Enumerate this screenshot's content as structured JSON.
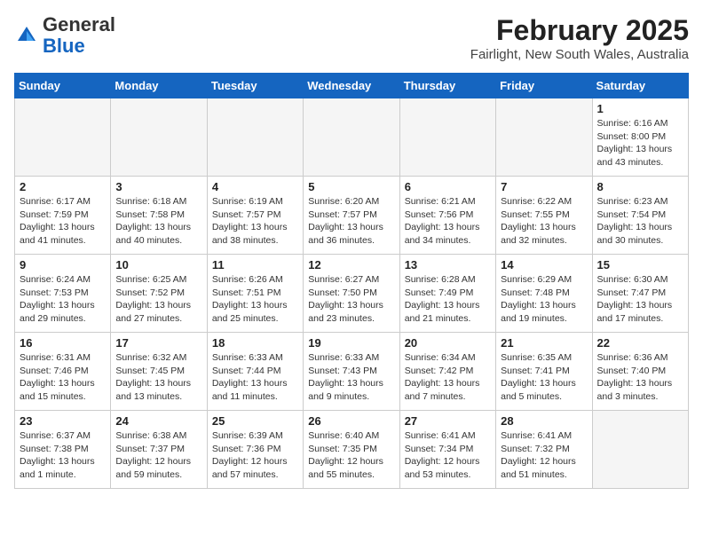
{
  "logo": {
    "general": "General",
    "blue": "Blue"
  },
  "title": "February 2025",
  "location": "Fairlight, New South Wales, Australia",
  "days_of_week": [
    "Sunday",
    "Monday",
    "Tuesday",
    "Wednesday",
    "Thursday",
    "Friday",
    "Saturday"
  ],
  "weeks": [
    [
      {
        "day": "",
        "detail": ""
      },
      {
        "day": "",
        "detail": ""
      },
      {
        "day": "",
        "detail": ""
      },
      {
        "day": "",
        "detail": ""
      },
      {
        "day": "",
        "detail": ""
      },
      {
        "day": "",
        "detail": ""
      },
      {
        "day": "1",
        "detail": "Sunrise: 6:16 AM\nSunset: 8:00 PM\nDaylight: 13 hours\nand 43 minutes."
      }
    ],
    [
      {
        "day": "2",
        "detail": "Sunrise: 6:17 AM\nSunset: 7:59 PM\nDaylight: 13 hours\nand 41 minutes."
      },
      {
        "day": "3",
        "detail": "Sunrise: 6:18 AM\nSunset: 7:58 PM\nDaylight: 13 hours\nand 40 minutes."
      },
      {
        "day": "4",
        "detail": "Sunrise: 6:19 AM\nSunset: 7:57 PM\nDaylight: 13 hours\nand 38 minutes."
      },
      {
        "day": "5",
        "detail": "Sunrise: 6:20 AM\nSunset: 7:57 PM\nDaylight: 13 hours\nand 36 minutes."
      },
      {
        "day": "6",
        "detail": "Sunrise: 6:21 AM\nSunset: 7:56 PM\nDaylight: 13 hours\nand 34 minutes."
      },
      {
        "day": "7",
        "detail": "Sunrise: 6:22 AM\nSunset: 7:55 PM\nDaylight: 13 hours\nand 32 minutes."
      },
      {
        "day": "8",
        "detail": "Sunrise: 6:23 AM\nSunset: 7:54 PM\nDaylight: 13 hours\nand 30 minutes."
      }
    ],
    [
      {
        "day": "9",
        "detail": "Sunrise: 6:24 AM\nSunset: 7:53 PM\nDaylight: 13 hours\nand 29 minutes."
      },
      {
        "day": "10",
        "detail": "Sunrise: 6:25 AM\nSunset: 7:52 PM\nDaylight: 13 hours\nand 27 minutes."
      },
      {
        "day": "11",
        "detail": "Sunrise: 6:26 AM\nSunset: 7:51 PM\nDaylight: 13 hours\nand 25 minutes."
      },
      {
        "day": "12",
        "detail": "Sunrise: 6:27 AM\nSunset: 7:50 PM\nDaylight: 13 hours\nand 23 minutes."
      },
      {
        "day": "13",
        "detail": "Sunrise: 6:28 AM\nSunset: 7:49 PM\nDaylight: 13 hours\nand 21 minutes."
      },
      {
        "day": "14",
        "detail": "Sunrise: 6:29 AM\nSunset: 7:48 PM\nDaylight: 13 hours\nand 19 minutes."
      },
      {
        "day": "15",
        "detail": "Sunrise: 6:30 AM\nSunset: 7:47 PM\nDaylight: 13 hours\nand 17 minutes."
      }
    ],
    [
      {
        "day": "16",
        "detail": "Sunrise: 6:31 AM\nSunset: 7:46 PM\nDaylight: 13 hours\nand 15 minutes."
      },
      {
        "day": "17",
        "detail": "Sunrise: 6:32 AM\nSunset: 7:45 PM\nDaylight: 13 hours\nand 13 minutes."
      },
      {
        "day": "18",
        "detail": "Sunrise: 6:33 AM\nSunset: 7:44 PM\nDaylight: 13 hours\nand 11 minutes."
      },
      {
        "day": "19",
        "detail": "Sunrise: 6:33 AM\nSunset: 7:43 PM\nDaylight: 13 hours\nand 9 minutes."
      },
      {
        "day": "20",
        "detail": "Sunrise: 6:34 AM\nSunset: 7:42 PM\nDaylight: 13 hours\nand 7 minutes."
      },
      {
        "day": "21",
        "detail": "Sunrise: 6:35 AM\nSunset: 7:41 PM\nDaylight: 13 hours\nand 5 minutes."
      },
      {
        "day": "22",
        "detail": "Sunrise: 6:36 AM\nSunset: 7:40 PM\nDaylight: 13 hours\nand 3 minutes."
      }
    ],
    [
      {
        "day": "23",
        "detail": "Sunrise: 6:37 AM\nSunset: 7:38 PM\nDaylight: 13 hours\nand 1 minute."
      },
      {
        "day": "24",
        "detail": "Sunrise: 6:38 AM\nSunset: 7:37 PM\nDaylight: 12 hours\nand 59 minutes."
      },
      {
        "day": "25",
        "detail": "Sunrise: 6:39 AM\nSunset: 7:36 PM\nDaylight: 12 hours\nand 57 minutes."
      },
      {
        "day": "26",
        "detail": "Sunrise: 6:40 AM\nSunset: 7:35 PM\nDaylight: 12 hours\nand 55 minutes."
      },
      {
        "day": "27",
        "detail": "Sunrise: 6:41 AM\nSunset: 7:34 PM\nDaylight: 12 hours\nand 53 minutes."
      },
      {
        "day": "28",
        "detail": "Sunrise: 6:41 AM\nSunset: 7:32 PM\nDaylight: 12 hours\nand 51 minutes."
      },
      {
        "day": "",
        "detail": ""
      }
    ]
  ]
}
